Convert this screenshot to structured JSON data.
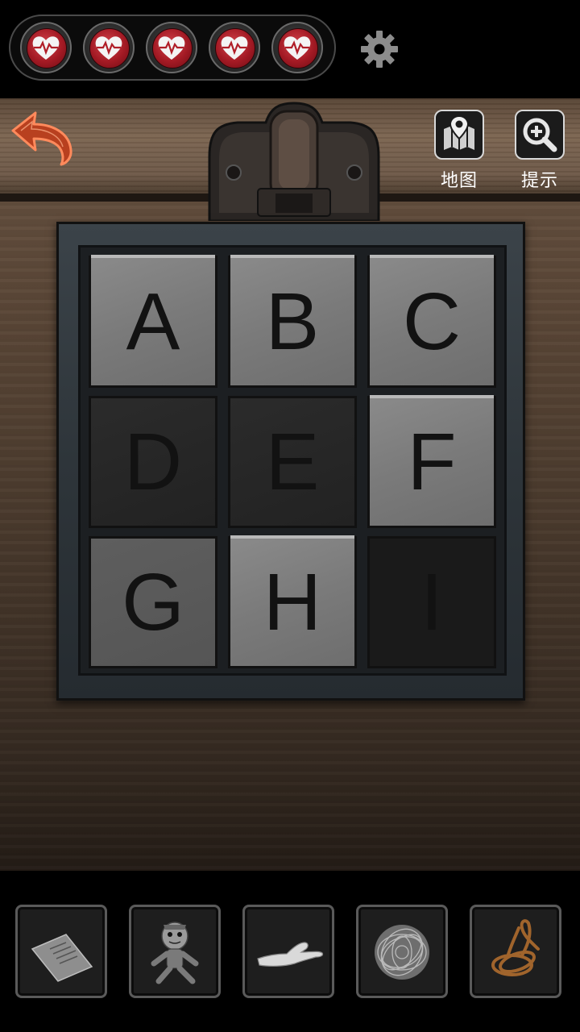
{
  "hud": {
    "lives": [
      "life-heart",
      "life-heart",
      "life-heart",
      "life-heart",
      "life-heart"
    ],
    "settings_icon": "gear-icon"
  },
  "toolbar": {
    "back_icon": "back-arrow-icon",
    "map_label": "地图",
    "hint_label": "提示"
  },
  "puzzle": {
    "tiles": [
      {
        "letter": "A",
        "shade": "light"
      },
      {
        "letter": "B",
        "shade": "light"
      },
      {
        "letter": "C",
        "shade": "light"
      },
      {
        "letter": "D",
        "shade": "dark"
      },
      {
        "letter": "E",
        "shade": "dark"
      },
      {
        "letter": "F",
        "shade": "light"
      },
      {
        "letter": "G",
        "shade": "mid"
      },
      {
        "letter": "H",
        "shade": "light"
      },
      {
        "letter": "I",
        "shade": "vdark"
      }
    ]
  },
  "inventory": {
    "items": [
      "note-paper",
      "rag-doll",
      "severed-hand",
      "steel-wool",
      "rope-coil"
    ]
  },
  "colors": {
    "heart_red": "#a31a24",
    "arrow_orange": "#e8623a",
    "wood": "#5c4838"
  }
}
